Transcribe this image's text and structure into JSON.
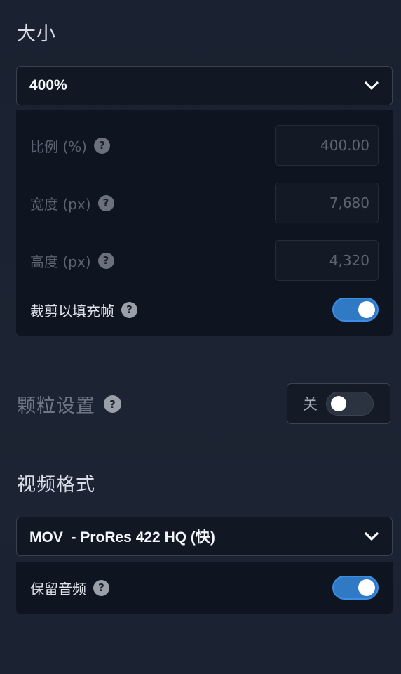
{
  "size_section": {
    "title": "大小",
    "dropdown_value": "400%",
    "scale": {
      "label": "比例 (%)",
      "value": "400.00"
    },
    "width": {
      "label": "宽度 (px)",
      "value": "7,680"
    },
    "height": {
      "label": "高度 (px)",
      "value": "4,320"
    },
    "crop_fill": {
      "label": "裁剪以填充帧",
      "enabled": true
    }
  },
  "grain_section": {
    "title": "颗粒设置",
    "toggle_label": "关",
    "enabled": false
  },
  "format_section": {
    "title": "视频格式",
    "dropdown_value": "MOV  - ProRes 422 HQ (快)",
    "keep_audio": {
      "label": "保留音频",
      "enabled": true
    }
  },
  "icons": {
    "help": "help-circle-icon",
    "dropdown": "chevron-down-icon"
  },
  "colors": {
    "accent": "#2f79c5",
    "panel": "#0f1520",
    "background": "#1a2130"
  }
}
